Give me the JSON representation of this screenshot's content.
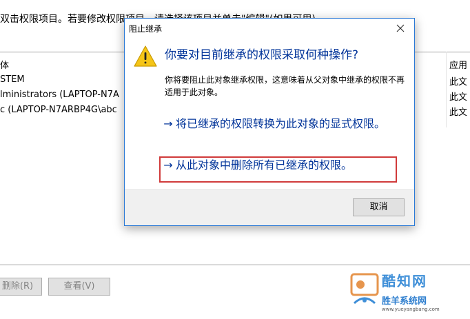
{
  "background": {
    "instruction": "双击权限项目。若要修改权限项目，请选择该项目并单击\"编辑\"(如果可用)。",
    "list_header_left": "体",
    "list_header_right": "应用",
    "rows": [
      {
        "principal": "STEM",
        "applies": "此文"
      },
      {
        "principal": "lministrators (LAPTOP-N7A",
        "applies": "此文"
      },
      {
        "principal": "c (LAPTOP-N7ARBP4G\\abc",
        "applies": "此文"
      }
    ],
    "buttons": {
      "remove": "删除(R)",
      "view": "查看(V)"
    }
  },
  "dialog": {
    "title": "阻止继承",
    "close_icon": "close-icon",
    "warning_icon": "warning-triangle-icon",
    "main_instruction": "你要对目前继承的权限采取何种操作?",
    "content": "你将要阻止此对象继承权限，这意味着从父对象中继承的权限不再适用于此对象。",
    "commands": [
      {
        "arrow": "→",
        "label": "将已继承的权限转换为此对象的显式权限。"
      },
      {
        "arrow": "→",
        "label": "从此对象中删除所有已继承的权限。"
      }
    ],
    "cancel_label": "取消",
    "highlight_color": "#d03a3a",
    "accent_color": "#003399"
  },
  "watermark": {
    "brand": "酷知网",
    "subtitle": "胜羊系统网",
    "url": "www.yueyangbang.com"
  }
}
